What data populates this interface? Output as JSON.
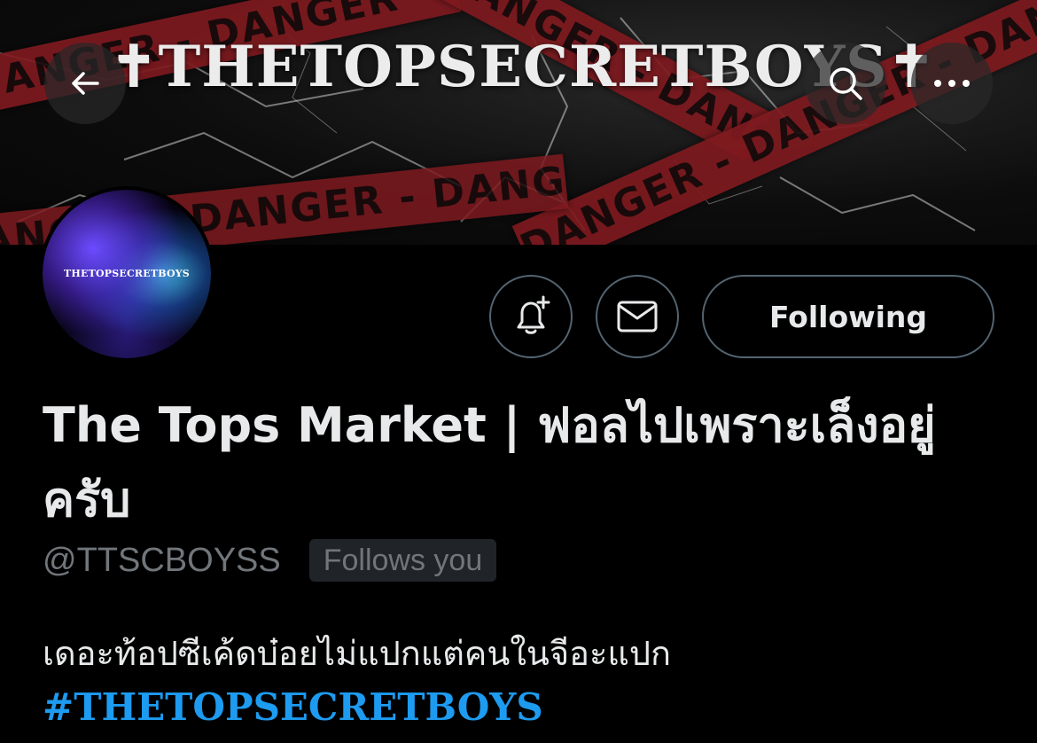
{
  "header": {
    "banner_title": "✝THETOPSECRETBOYS✝",
    "banner_tape_text": "DANGER - DANGER - DANGER",
    "tape_color": "#7e1a1f"
  },
  "nav": {
    "back_icon": "back-arrow-icon",
    "search_icon": "search-icon",
    "more_icon": "more-icon"
  },
  "avatar": {
    "label": "THETOPSECRETBOYS"
  },
  "actions": {
    "notify_icon": "bell-plus-icon",
    "message_icon": "mail-icon",
    "following_label": "Following"
  },
  "profile": {
    "display_name": "The Tops Market | ฟอลไปเพราะเล็งอยู่ครับ",
    "handle": "@TTSCBOYSS",
    "follows_you": "Follows you",
    "bio_text": "เดอะท้อปซีเค้ดบ๋อยไม่แปกแต่คนในจีอะแปก",
    "bio_hashtag": "#THETOPSECRETBOYS"
  },
  "colors": {
    "background": "#000000",
    "text": "#e7e9ea",
    "muted": "#71767b",
    "link": "#1d9bf0",
    "border": "#536471"
  }
}
